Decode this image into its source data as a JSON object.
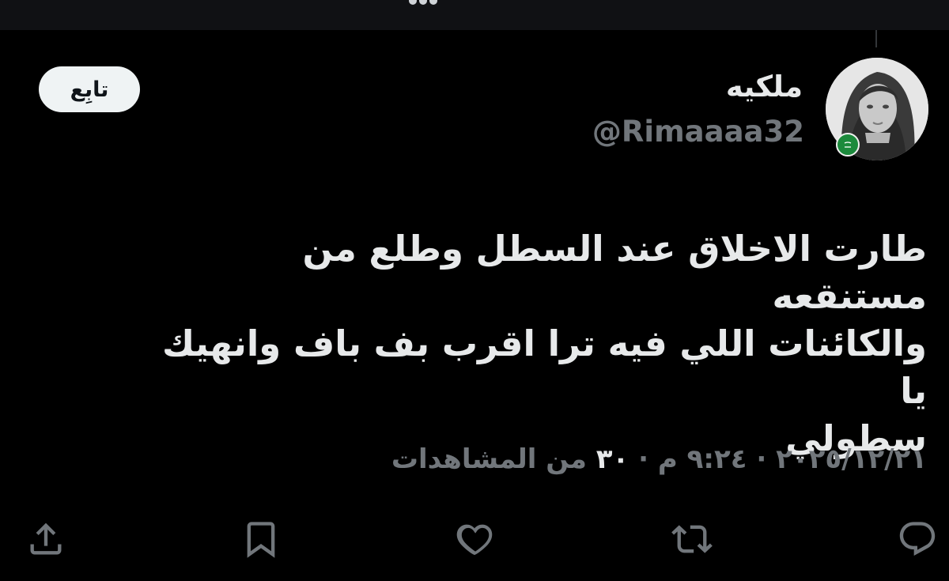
{
  "user": {
    "display_name": "ملكيه",
    "handle": "@Rimaaaa32",
    "avatar": "woman-portrait-avatar",
    "badge": "saudi-flag-icon"
  },
  "follow_button": {
    "label": "تابِع"
  },
  "tweet": {
    "lines": [
      "طارت الاخلاق عند السطل وطلع من مستنقعه",
      "والكائنات اللي فيه ترا اقرب بف باف وانهيك يا",
      "سطولي"
    ]
  },
  "meta": {
    "date": "٢٠٢٥/١٢/٢١",
    "time": "٩:٢٤ م",
    "separator": "·",
    "views_count": "٣٠",
    "views_label": "من المشاهدات"
  },
  "actions": [
    {
      "icon": "reply-icon"
    },
    {
      "icon": "retweet-icon"
    },
    {
      "icon": "like-icon"
    },
    {
      "icon": "bookmark-icon"
    },
    {
      "icon": "share-icon"
    }
  ],
  "colors": {
    "background": "#000000",
    "primary_text": "#e7e9ea",
    "secondary_text": "#71767b",
    "follow_bg": "#eff3f4"
  }
}
